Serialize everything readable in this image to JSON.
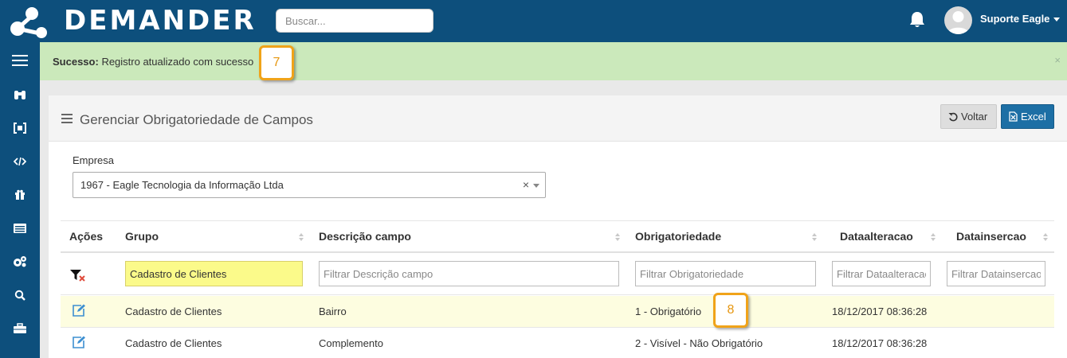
{
  "header": {
    "brand": "DEMANDER",
    "search_placeholder": "Buscar...",
    "user_name": "Suporte Eagle"
  },
  "sidebar": {
    "icons": [
      "menu-icon",
      "binoculars-icon",
      "code-bracket-icon",
      "code-icon",
      "gift-icon",
      "list-icon",
      "cogs-icon",
      "search-icon",
      "briefcase-icon"
    ]
  },
  "alert": {
    "label": "Sucesso:",
    "message": "Registro atualizado com sucesso",
    "close": "×",
    "badge": "7"
  },
  "panel": {
    "title": "Gerenciar Obrigatoriedade de Campos",
    "voltar_label": "Voltar",
    "excel_label": "Excel"
  },
  "empresa": {
    "label": "Empresa",
    "value": "1967 - Eagle Tecnologia da Informação Ltda",
    "clear": "×"
  },
  "table": {
    "columns": [
      "Ações",
      "Grupo",
      "Descrição campo",
      "Obrigatoriedade",
      "Dataalteracao",
      "Datainsercao"
    ],
    "filters": {
      "grupo_value": "Cadastro de Clientes",
      "descricao_placeholder": "Filtrar Descrição campo",
      "obrigatoriedade_placeholder": "Filtrar Obrigatoriedade",
      "dataalteracao_placeholder": "Filtrar Dataalteracao",
      "datainsercao_placeholder": "Filtrar Datainsercao"
    },
    "rows": [
      {
        "grupo": "Cadastro de Clientes",
        "descricao": "Bairro",
        "obrigatoriedade": "1 - Obrigatório",
        "dataalteracao": "18/12/2017 08:36:28",
        "datainsercao": ""
      },
      {
        "grupo": "Cadastro de Clientes",
        "descricao": "Complemento",
        "obrigatoriedade": "2 - Visível - Não Obrigatório",
        "dataalteracao": "18/12/2017 08:36:28",
        "datainsercao": ""
      }
    ],
    "badge": "8"
  },
  "colors": {
    "navy": "#0d4f7c",
    "alert_green": "#cbe9bb",
    "badge_orange": "#f0a319",
    "excel_blue": "#1d6fa5",
    "highlight_yellow": "#fbfa8a"
  }
}
